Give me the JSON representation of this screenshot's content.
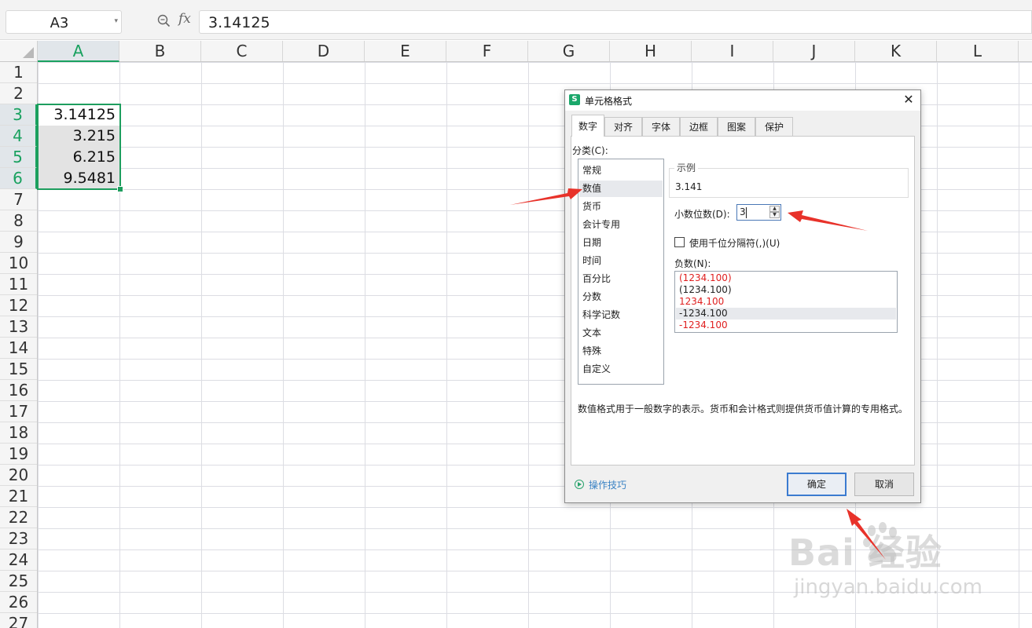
{
  "formula_bar": {
    "name_box": "A3",
    "fx_label": "fx",
    "formula": "3.14125"
  },
  "sheet": {
    "columns": [
      "A",
      "B",
      "C",
      "D",
      "E",
      "F",
      "G",
      "H",
      "I",
      "J",
      "K",
      "L"
    ],
    "selected_column": "A",
    "rows": [
      "1",
      "2",
      "3",
      "4",
      "5",
      "6",
      "7",
      "8",
      "9",
      "10",
      "11",
      "12",
      "13",
      "14",
      "15",
      "16",
      "17",
      "18",
      "19",
      "20",
      "21",
      "22",
      "23",
      "24",
      "25",
      "26",
      "27"
    ],
    "selected_rows": [
      "3",
      "4",
      "5",
      "6"
    ],
    "cells": {
      "A3": "3.14125",
      "A4": "3.215",
      "A5": "6.215",
      "A6": "9.5481"
    }
  },
  "dialog": {
    "title": "单元格格式",
    "logo_letter": "S",
    "close_glyph": "✕",
    "tabs": [
      "数字",
      "对齐",
      "字体",
      "边框",
      "图案",
      "保护"
    ],
    "active_tab": "数字",
    "category_label": "分类(C):",
    "categories": [
      "常规",
      "数值",
      "货币",
      "会计专用",
      "日期",
      "时间",
      "百分比",
      "分数",
      "科学记数",
      "文本",
      "特殊",
      "自定义"
    ],
    "selected_category": "数值",
    "sample_legend": "示例",
    "sample_value": "3.141",
    "decimal_label": "小数位数(D):",
    "decimal_value": "3",
    "thousands_label": "使用千位分隔符(,)(U)",
    "thousands_checked": false,
    "negative_label": "负数(N):",
    "negative_options": [
      {
        "text": "(1234.100)",
        "color": "#e02020"
      },
      {
        "text": "(1234.100)",
        "color": "#222222"
      },
      {
        "text": "1234.100",
        "color": "#e02020"
      },
      {
        "text": "-1234.100",
        "color": "#222222"
      },
      {
        "text": "-1234.100",
        "color": "#e02020"
      }
    ],
    "selected_negative": 3,
    "description": "数值格式用于一般数字的表示。货币和会计格式则提供货币值计算的专用格式。",
    "tips_label": "操作技巧",
    "ok_label": "确定",
    "cancel_label": "取消"
  },
  "watermark": {
    "brand": "Bai  经验",
    "url": "jingyan.baidu.com"
  },
  "colors": {
    "selection_green": "#1e9e5e",
    "annotation_red": "#e8322a",
    "dialog_focus_blue": "#3b7bd0"
  }
}
